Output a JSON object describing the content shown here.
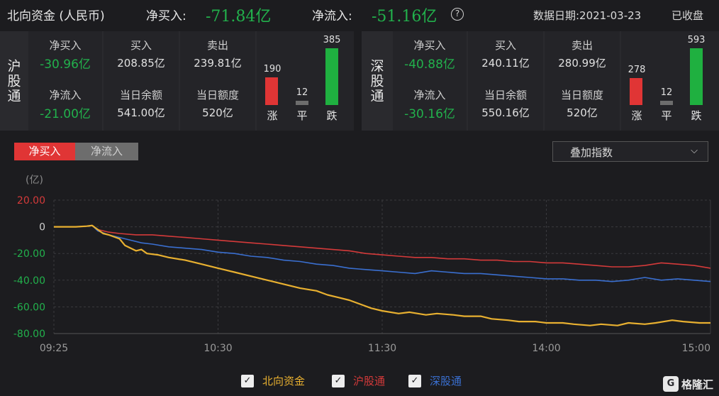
{
  "header": {
    "title": "北向资金 (人民币)",
    "net_buy_label": "净买入:",
    "net_buy_value": "-71.84亿",
    "net_inflow_label": "净流入:",
    "net_inflow_value": "-51.16亿",
    "help_glyph": "?",
    "date_text": "数据日期:2021-03-23",
    "status_text": "已收盘"
  },
  "sh": {
    "label": "沪股通",
    "net_buy_label": "净买入",
    "net_buy_value": "-30.96亿",
    "buy_label": "买入",
    "buy_value": "208.85亿",
    "sell_label": "卖出",
    "sell_value": "239.81亿",
    "net_inflow_label": "净流入",
    "net_inflow_value": "-21.00亿",
    "balance_label": "当日余额",
    "balance_value": "541.00亿",
    "quota_label": "当日额度",
    "quota_value": "520亿",
    "up_count": 190,
    "flat_count": 12,
    "down_count": 385,
    "up_count_text": "190",
    "flat_count_text": "12",
    "down_count_text": "385",
    "up_label": "涨",
    "flat_label": "平",
    "down_label": "跌"
  },
  "sz": {
    "label": "深股通",
    "net_buy_label": "净买入",
    "net_buy_value": "-40.88亿",
    "buy_label": "买入",
    "buy_value": "240.11亿",
    "sell_label": "卖出",
    "sell_value": "280.99亿",
    "net_inflow_label": "净流入",
    "net_inflow_value": "-30.16亿",
    "balance_label": "当日余额",
    "balance_value": "550.16亿",
    "quota_label": "当日额度",
    "quota_value": "520亿",
    "up_count": 278,
    "flat_count": 12,
    "down_count": 593,
    "up_count_text": "278",
    "flat_count_text": "12",
    "down_count_text": "593",
    "up_label": "涨",
    "flat_label": "平",
    "down_label": "跌"
  },
  "tabs": {
    "net_buy": "净买入",
    "net_inflow": "净流入"
  },
  "overlay": {
    "label": "叠加指数",
    "chevron": "⌵"
  },
  "legend": {
    "north": "北向资金",
    "sh": "沪股通",
    "sz": "深股通",
    "check": "✓"
  },
  "colors": {
    "north": "#e8b030",
    "sh": "#d43a3a",
    "sz": "#3a6fd0",
    "up": "#e03535",
    "flat": "#6d6d6d",
    "down": "#1fb040",
    "green_text": "#22b14c",
    "tab_active": "#e03535"
  },
  "watermark": {
    "icon": "G",
    "text": "格隆汇"
  },
  "chart_data": {
    "type": "line",
    "unit_label": "(亿)",
    "ylim": [
      -80,
      20
    ],
    "yticks": [
      20,
      0,
      -20,
      -40,
      -60,
      -80
    ],
    "ytick_labels": [
      "20.00",
      "0",
      "-20.00",
      "-40.00",
      "-60.00",
      "-80.00"
    ],
    "xticks": [
      0,
      60,
      120,
      180,
      240
    ],
    "xtick_labels": [
      "09:25",
      "10:30",
      "11:30",
      "14:00",
      "15:00"
    ],
    "xlim": [
      0,
      240
    ],
    "series": [
      {
        "name": "北向资金",
        "color": "#e8b030",
        "x": [
          0,
          4,
          8,
          12,
          14,
          16,
          18,
          20,
          24,
          26,
          30,
          32,
          34,
          38,
          42,
          48,
          54,
          60,
          66,
          72,
          78,
          84,
          90,
          96,
          100,
          104,
          108,
          112,
          116,
          120,
          126,
          130,
          136,
          140,
          146,
          150,
          156,
          160,
          166,
          170,
          176,
          180,
          186,
          190,
          196,
          200,
          206,
          210,
          216,
          220,
          226,
          230,
          236,
          240
        ],
        "y": [
          0,
          0,
          0,
          0.5,
          1,
          -2,
          -5,
          -6,
          -9,
          -14,
          -18,
          -17,
          -20,
          -21,
          -23,
          -25,
          -28,
          -31,
          -34,
          -37,
          -40,
          -43,
          -46,
          -48,
          -51,
          -53,
          -55,
          -58,
          -61,
          -63,
          -65,
          -64,
          -66,
          -65,
          -66,
          -67,
          -67,
          -69,
          -70,
          -71,
          -71,
          -72,
          -72,
          -73,
          -74,
          -73,
          -74,
          -72,
          -73,
          -72,
          -70,
          -71,
          -72,
          -72
        ]
      },
      {
        "name": "沪股通",
        "color": "#d43a3a",
        "x": [
          0,
          4,
          8,
          12,
          14,
          16,
          20,
          24,
          30,
          36,
          42,
          48,
          54,
          60,
          66,
          72,
          78,
          84,
          90,
          96,
          102,
          108,
          114,
          120,
          126,
          132,
          138,
          144,
          150,
          156,
          162,
          168,
          174,
          180,
          186,
          192,
          198,
          204,
          210,
          216,
          222,
          228,
          234,
          240
        ],
        "y": [
          0,
          0,
          0,
          0.5,
          1,
          -2,
          -4,
          -5,
          -6,
          -6,
          -7,
          -8,
          -9,
          -10,
          -11,
          -12,
          -13,
          -14,
          -15,
          -16,
          -17,
          -18,
          -20,
          -21,
          -22,
          -23,
          -23,
          -24,
          -24,
          -25,
          -25,
          -26,
          -26,
          -27,
          -27,
          -28,
          -29,
          -30,
          -30,
          -29,
          -27,
          -28,
          -29,
          -31
        ]
      },
      {
        "name": "深股通",
        "color": "#3a6fd0",
        "x": [
          0,
          4,
          8,
          12,
          14,
          16,
          20,
          24,
          28,
          32,
          36,
          42,
          48,
          54,
          60,
          66,
          72,
          78,
          84,
          90,
          96,
          102,
          108,
          114,
          120,
          126,
          132,
          138,
          144,
          150,
          156,
          162,
          168,
          174,
          180,
          186,
          192,
          198,
          204,
          210,
          216,
          222,
          228,
          234,
          240
        ],
        "y": [
          0,
          0,
          0,
          0.5,
          1,
          -3,
          -6,
          -8,
          -10,
          -12,
          -13,
          -15,
          -16,
          -17,
          -19,
          -20,
          -22,
          -23,
          -25,
          -26,
          -28,
          -29,
          -31,
          -32,
          -33,
          -34,
          -35,
          -33,
          -34,
          -35,
          -35,
          -36,
          -37,
          -38,
          -39,
          -39,
          -40,
          -40,
          -41,
          -40,
          -38,
          -40,
          -39,
          -40,
          -41
        ]
      }
    ]
  }
}
